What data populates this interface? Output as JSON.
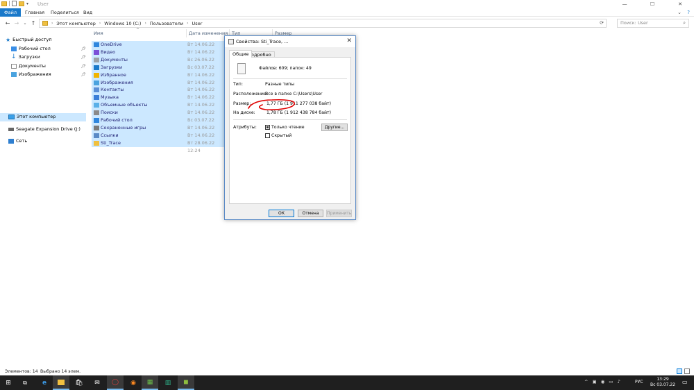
{
  "window": {
    "title": "User",
    "controls": {
      "minimize": "—",
      "maximize": "☐",
      "close": "✕"
    }
  },
  "ribbon": {
    "tabs": [
      "Файл",
      "Главная",
      "Поделиться",
      "Вид"
    ],
    "expand": "⌄",
    "help": "?"
  },
  "address": {
    "back": "←",
    "forward": "→",
    "dropdown": "⌄",
    "up": "↑",
    "crumbs": [
      "Этот компьютер",
      "Windows 10 (C:)",
      "Пользователи",
      "User"
    ],
    "refresh": "⟳",
    "search_placeholder": "Поиск: User"
  },
  "nav": {
    "quick_access": "Быстрый доступ",
    "quick_items": [
      "Рабочий стол",
      "Загрузки",
      "Документы",
      "Изображения"
    ],
    "this_pc": "Этот компьютер",
    "drive": "Seagate Expansion Drive (J:)",
    "network": "Сеть"
  },
  "columns": {
    "name": "Имя",
    "date": "Дата изменения",
    "type": "Тип",
    "size": "Размер"
  },
  "files": [
    {
      "name": "OneDrive",
      "date": "Вт 14.06.22 14:25",
      "icon": "cloud"
    },
    {
      "name": "Видео",
      "date": "Вт 14.06.22 14:25",
      "icon": "video"
    },
    {
      "name": "Документы",
      "date": "Вс 26.06.22 17:41",
      "icon": "docs"
    },
    {
      "name": "Загрузки",
      "date": "Вс 03.07.22 13:00",
      "icon": "download"
    },
    {
      "name": "Избранное",
      "date": "Вт 14.06.22 14:25",
      "icon": "star"
    },
    {
      "name": "Изображения",
      "date": "Вт 14.06.22 14:25",
      "icon": "pictures"
    },
    {
      "name": "Контакты",
      "date": "Вт 14.06.22 14:25",
      "icon": "contacts"
    },
    {
      "name": "Музыка",
      "date": "Вт 14.06.22 14:25",
      "icon": "music"
    },
    {
      "name": "Объемные объекты",
      "date": "Вт 14.06.22 14:25",
      "icon": "3d"
    },
    {
      "name": "Поиски",
      "date": "Вт 14.06.22 14:24",
      "icon": "search"
    },
    {
      "name": "Рабочий стол",
      "date": "Вс 03.07.22 13:29",
      "icon": "desktop"
    },
    {
      "name": "Сохраненные игры",
      "date": "Вт 14.06.22 14:25",
      "icon": "games"
    },
    {
      "name": "Ссылки",
      "date": "Вт 14.06.22 14:25",
      "icon": "links"
    },
    {
      "name": "Sti_Trace",
      "date": "Вт 28.06.22 12:24",
      "icon": "folder"
    }
  ],
  "dialog": {
    "title": "Свойства: Sti_Trace, ...",
    "close": "✕",
    "tabs": [
      "Общие",
      "Подробно"
    ],
    "summary": "Файлов: 609; папок: 49",
    "type_label": "Тип:",
    "type_value": "Разные типы",
    "location_label": "Расположение:",
    "location_value": "Все в папке C:\\Users\\User",
    "size_label": "Размер:",
    "size_value": "1,77 ГБ (1 911 277 038 байт)",
    "ondisk_label": "На диске:",
    "ondisk_value": "1,78 ГБ (1 912 438 784 байт)",
    "attributes_label": "Атрибуты:",
    "readonly_label": "Только чтение",
    "hidden_label": "Скрытый",
    "other_button": "Другие...",
    "ok": "ОК",
    "cancel": "Отмена",
    "apply": "Применить"
  },
  "status": {
    "items": "Элементов: 14",
    "selected": "Выбрано 14 элем."
  },
  "taskbar": {
    "language": "РУС",
    "time": "13:29",
    "date": "Вс 03.07.22",
    "tray_icons": [
      "^",
      "▣",
      "◉",
      "▭",
      "♪"
    ]
  },
  "colors": {
    "accent": "#1979ca",
    "selection": "#cce8ff",
    "annotation": "#e00000"
  }
}
